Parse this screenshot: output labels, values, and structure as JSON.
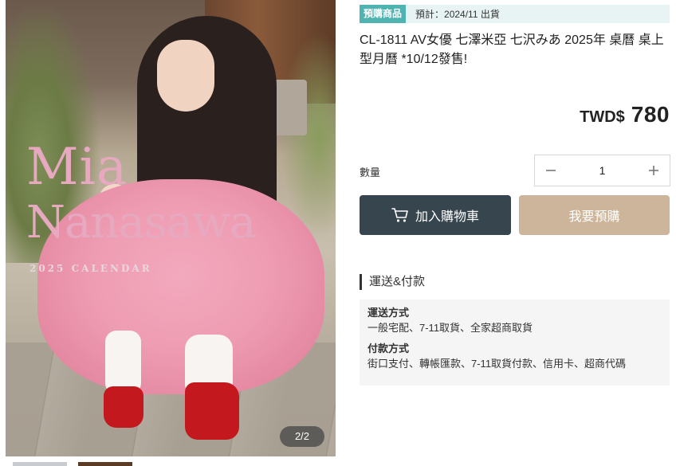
{
  "gallery": {
    "overlay_title_line1": "Mia",
    "overlay_title_line2": "Nanasawa",
    "overlay_subtitle": "2025 CALENDAR",
    "counter": "2/2"
  },
  "preorder": {
    "badge": "預購商品",
    "estimate": "預計：2024/11 出貨"
  },
  "product": {
    "title": "CL-1811 AV女優 七澤米亞 七沢みあ 2025年 桌曆 桌上型月曆 *10/12發售!",
    "currency": "TWD$",
    "price": "780"
  },
  "quantity": {
    "label": "數量",
    "value": "1",
    "decrement_symbol": "−",
    "increment_symbol": "+"
  },
  "actions": {
    "add_to_cart": "加入購物車",
    "preorder": "我要預購",
    "cart_icon": "shopping-cart-icon"
  },
  "shipping": {
    "section_title": "運送&付款",
    "delivery_heading": "運送方式",
    "delivery_text": "一般宅配、7-11取貨、全家超商取貨",
    "payment_heading": "付款方式",
    "payment_text": "街口支付、轉帳匯款、7-11取貨付款、信用卡、超商代碼"
  },
  "colors": {
    "preorder_badge": "#4fb3b1",
    "preorder_bar": "#e8f3f3",
    "cart_button": "#37454f",
    "preorder_button": "#ccb59a"
  }
}
